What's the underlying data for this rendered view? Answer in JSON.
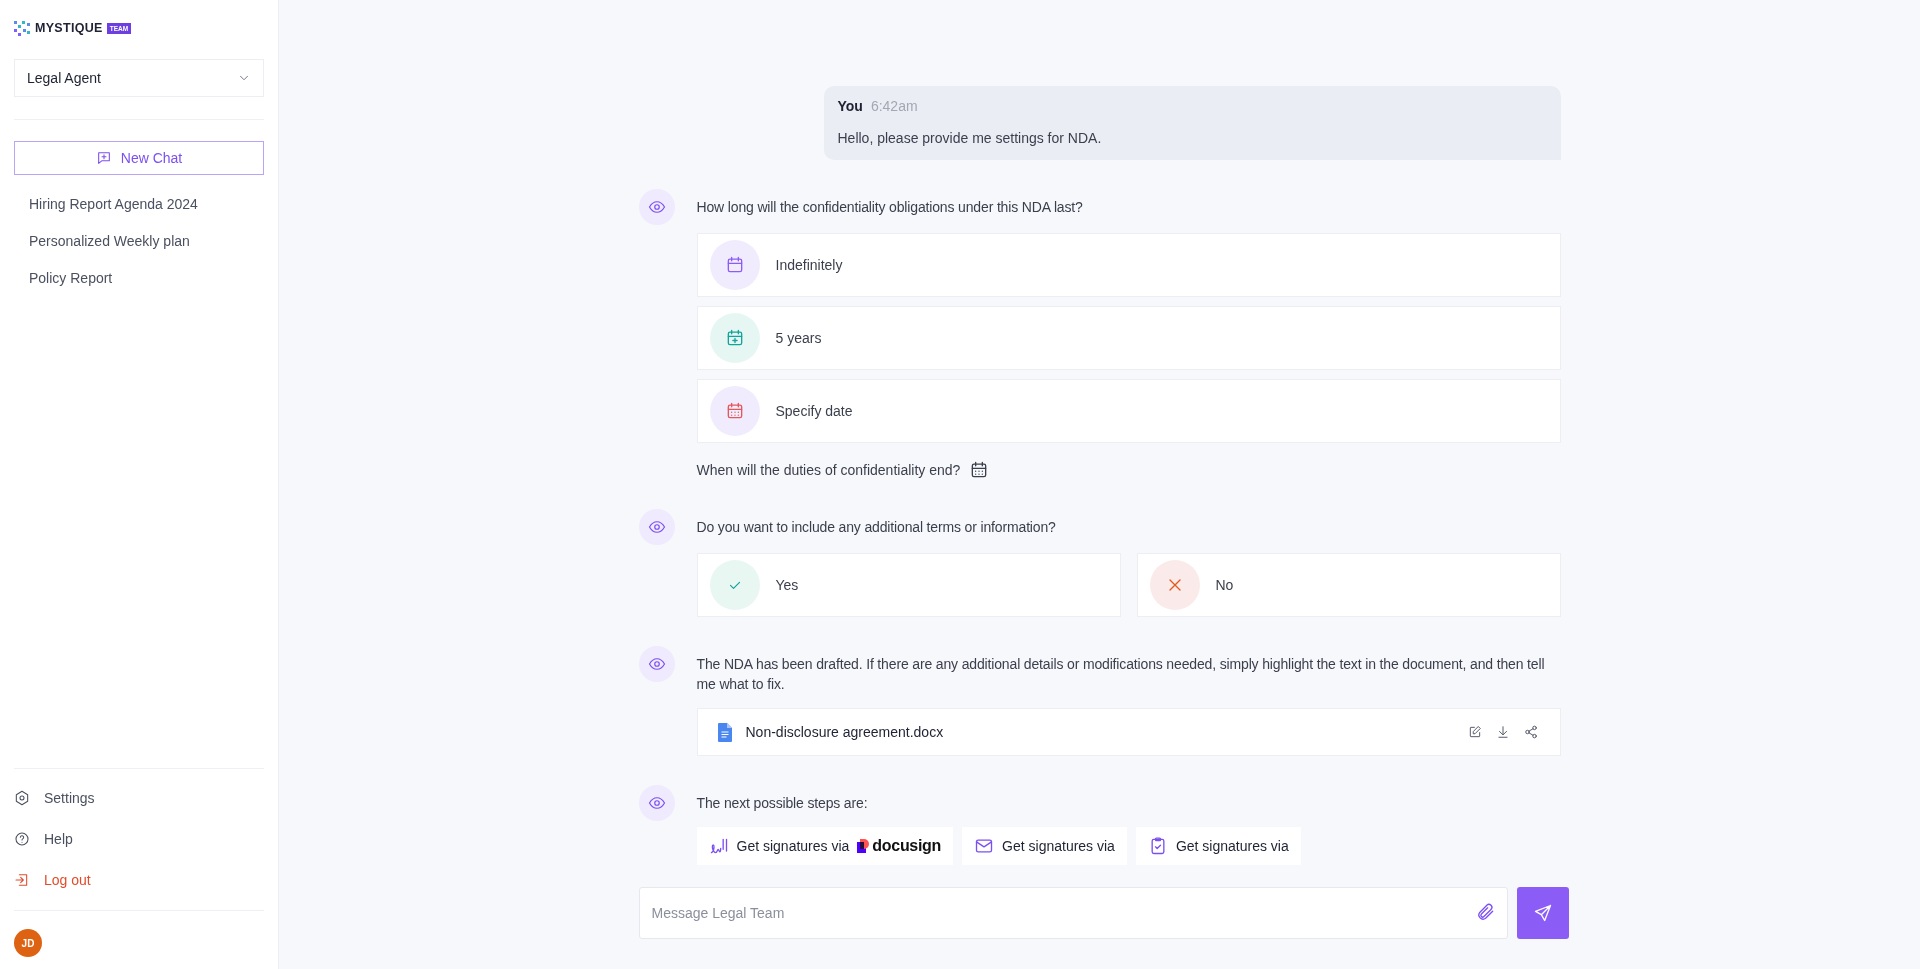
{
  "sidebar": {
    "logo": {
      "name": "MYSTIQUE",
      "badge": "TEAM"
    },
    "agent_select": {
      "value": "Legal Agent"
    },
    "new_chat": {
      "label": "New Chat"
    },
    "chats": [
      {
        "label": "Hiring Report Agenda 2024"
      },
      {
        "label": "Personalized Weekly plan"
      },
      {
        "label": "Policy Report"
      }
    ],
    "bottom_items": [
      {
        "label": "Settings",
        "kind": "settings"
      },
      {
        "label": "Help",
        "kind": "help"
      },
      {
        "label": "Log out",
        "kind": "logout"
      }
    ],
    "avatar": {
      "initials": "JD"
    }
  },
  "user_message": {
    "author": "You",
    "time": "6:42am",
    "text": "Hello, please provide me settings for NDA."
  },
  "assistant_messages": [
    {
      "kind": "options",
      "text": "How long will the confidentiality obligations under this NDA last?",
      "options": [
        {
          "label": "Indefinitely",
          "kind": "calendar",
          "color": "#8b5cf6"
        },
        {
          "label": "5 years",
          "kind": "calendar-plus",
          "color": "#14a39b"
        },
        {
          "label": "Specify date",
          "kind": "calendar-grid",
          "color": "#e5575b"
        }
      ],
      "followup": "When will the duties of confidentiality end?"
    },
    {
      "kind": "choices",
      "text": "Do you want to include any additional terms or information?",
      "options": [
        {
          "label": "Yes",
          "kind": "yes"
        },
        {
          "label": "No",
          "kind": "no"
        }
      ]
    },
    {
      "kind": "document",
      "text": "The NDA has been drafted. If there are any additional details or modifications needed, simply highlight the text in the document, and then tell me what to fix.",
      "file": {
        "name": "Non-disclosure agreement.docx"
      }
    },
    {
      "kind": "actions",
      "text": "The next possible steps are:",
      "actions": [
        {
          "label": "Get signatures via",
          "kind": "signature",
          "brand": "docusign"
        },
        {
          "label": "Get signatures via",
          "kind": "mail"
        },
        {
          "label": "Get signatures via",
          "kind": "clipboard"
        }
      ]
    }
  ],
  "composer": {
    "placeholder": "Message Legal Team"
  }
}
